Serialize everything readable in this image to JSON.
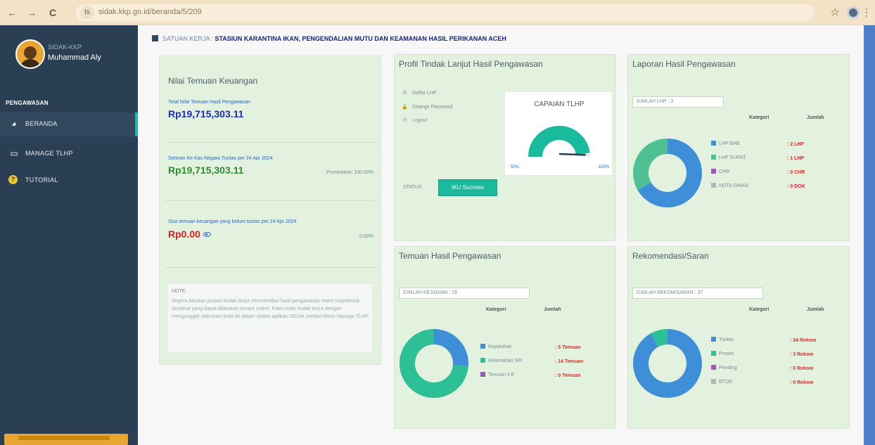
{
  "browser": {
    "back_icon": "←",
    "forward_icon": "→",
    "reload_icon": "C",
    "url_icon": "ts",
    "url": "sidak.kkp.go.id/beranda/5/209",
    "star_icon": "☆",
    "menu_icon": "⋮"
  },
  "sidebar": {
    "welcome": "SIDAK-KKP",
    "user_name": "Muhammad Aly",
    "section_title": "PENGAWASAN",
    "items": [
      {
        "label": "BERANDA",
        "icon": "◕",
        "active": true
      },
      {
        "label": "MANAGE TLHP",
        "icon": "▭",
        "active": false
      },
      {
        "label": "TUTORIAL",
        "icon": "?",
        "active": false
      }
    ]
  },
  "header": {
    "satuan_label": "SATUAN KERJA :",
    "satuan_name": "STASIUN KARANTINA IKAN, PENGENDALIAN MUTU DAN KEAMANAN HASIL PERIKANAN ACEH"
  },
  "finance": {
    "title": "Nilai Temuan Keuangan",
    "total_label": "Total Nilai Temuan Hasil Pengawasan",
    "total_value": "Rp19,715,303.11",
    "setoran_label": "Setoran Ke Kas Negara Tuntas per 24 Apr 2024",
    "setoran_value": "Rp19,715,303.11",
    "setoran_pct": "Prosentase: 100.00%",
    "sisa_label": "Sisa temuan keuangan yang belum tuntas per 24 Apr 2024",
    "sisa_value": "Rp0.00",
    "sisa_pct": "0.00%",
    "note_title": "NOTE:",
    "note_text": "Segera lakukan proses tindak lanjut rekomendasi hasil pengawasan intern Inspektorat Jenderal yang dapat dilakukan secara online. Klaim bukti tindak lanjut dengan mengunggah dokumen bukti ke dalam sistem aplikasi SIDAK melalui Menu Manage TLHP."
  },
  "profil": {
    "title": "Profil Tindak Lanjut Hasil Pengawasan",
    "links": [
      {
        "icon": "☰",
        "label": "Daftar LHP"
      },
      {
        "icon": "🔒",
        "label": "Change Password"
      },
      {
        "icon": "⏻",
        "label": "Logout"
      }
    ],
    "gauge_title": "CAPAIAN TLHP",
    "gauge_min": "50%",
    "gauge_max": "100%",
    "gauge_value": 0.96,
    "status_label": "STATUS",
    "status_button": "IKU Success"
  },
  "laporan": {
    "title": "Laporan Hasil Pengawasan",
    "count_label": "JUMLAH LHP : 3",
    "col_kategori": "Kategori",
    "col_jumlah": "Jumlah",
    "rows": [
      {
        "name": "LHP BAB",
        "value": ": 2 LHP",
        "color": "#3f8ed8",
        "count": 2
      },
      {
        "name": "LHP SURAT",
        "value": ": 1 LHP",
        "color": "#4fbf94",
        "count": 1
      },
      {
        "name": "CHR",
        "value": ": 0 CHR",
        "color": "#9b59b6",
        "count": 0
      },
      {
        "name": "NOTA DINAS",
        "value": ": 0 DOK",
        "color": "#b0b6bc",
        "count": 0
      }
    ]
  },
  "temuan": {
    "title": "Temuan Hasil Pengawasan",
    "count_label": "JUMLAH KEJADIAN : 19",
    "col_kategori": "Kategori",
    "col_jumlah": "Jumlah",
    "rows": [
      {
        "name": "Kepatuhan",
        "value": ": 5 Temuan",
        "color": "#3f8ed8",
        "count": 5
      },
      {
        "name": "Kelemahan SPI",
        "value": ": 14 Temuan",
        "color": "#2dbf95",
        "count": 14
      },
      {
        "name": "Temuan 3 E",
        "value": ": 0 Temuan",
        "color": "#9b59b6",
        "count": 0
      }
    ]
  },
  "rekomendasi": {
    "title": "Rekomendasi/Saran",
    "count_label": "JUMLAH REKOM/SARAN : 37",
    "col_kategori": "Kategori",
    "col_jumlah": "Jumlah",
    "rows": [
      {
        "name": "Tuntas",
        "value": ": 34 Rekom",
        "color": "#3f8ed8",
        "count": 34
      },
      {
        "name": "Proses",
        "value": ": 3 Rekom",
        "color": "#2dbf95",
        "count": 3
      },
      {
        "name": "Pending",
        "value": ": 0 Rekom",
        "color": "#9b59b6",
        "count": 0
      },
      {
        "name": "BTDD",
        "value": ": 0 Rekom",
        "color": "#b0b6bc",
        "count": 0
      }
    ]
  }
}
